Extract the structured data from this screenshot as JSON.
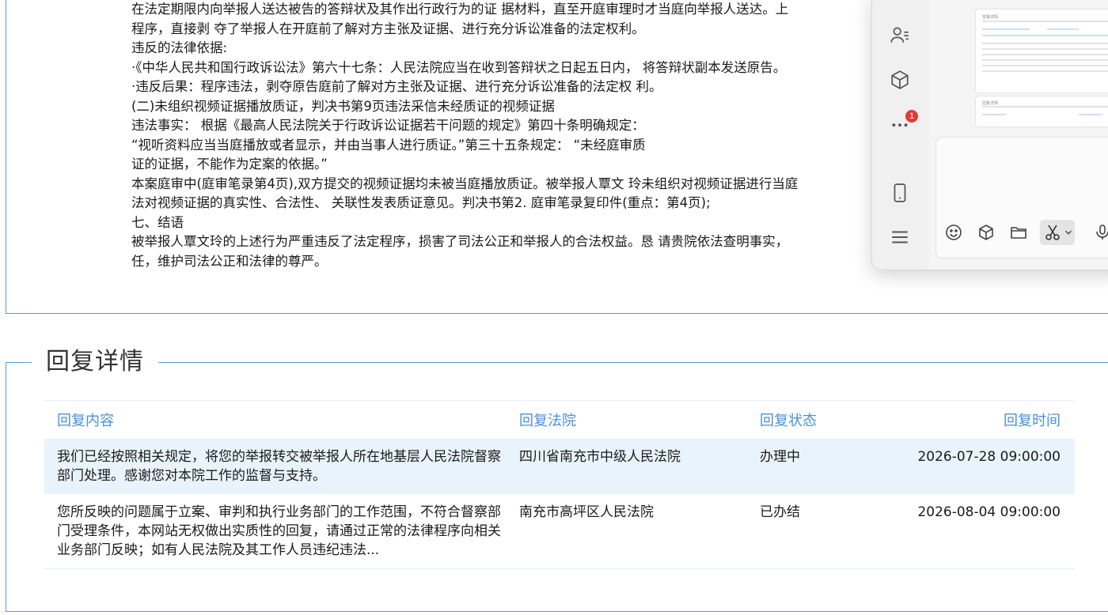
{
  "report": {
    "lines": [
      "在法定期限内向举报人送达被告的答辩状及其作出行政行为的证 据材料，直至开庭审理时才当庭向举报人送达。上",
      "程序，直接剥 夺了举报人在开庭前了解对方主张及证据、进行充分诉讼准备的法定权利。",
      "违反的法律依据:",
      "·《中华人民共和国行政诉讼法》第六十七条：人民法院应当在收到答辩状之日起五日内， 将答辩状副本发送原告。",
      "·违反后果：程序违法，剥夺原告庭前了解对方主张及证据、进行充分诉讼准备的法定权 利。",
      "(二)未组织视频证据播放质证，判决书第9页违法采信未经质证的视频证据",
      "违法事实： 根据《最高人民法院关于行政诉讼证据若干问题的规定》第四十条明确规定：",
      "“视听资料应当当庭播放或者显示，并由当事人进行质证。”第三十五条规定： “未经庭审质",
      "证的证据，不能作为定案的依据。”",
      "本案庭审中(庭审笔录第4页),双方提交的视频证据均未被当庭播放质证。被举报人覃文 玲未组织对视频证据进行当庭",
      "法对视频证据的真实性、合法性、 关联性发表质证意见。判决书第2. 庭审笔录复印件(重点：第4页);",
      "七、结语",
      "被举报人覃文玲的上述行为严重违反了法定程序，损害了司法公正和举报人的合法权益。恳 请贵院依法查明事实，",
      "任，维护司法公正和法律的尊严。"
    ]
  },
  "reply": {
    "legend": "回复详情",
    "headers": {
      "content": "回复内容",
      "court": "回复法院",
      "status": "回复状态",
      "time": "回复时间"
    },
    "rows": [
      {
        "content": "我们已经按照相关规定，将您的举报转交被举报人所在地基层人民法院督察部门处理。感谢您对本院工作的监督与支持。",
        "court": "四川省南充市中级人民法院",
        "status": "办理中",
        "time": "2026-07-28 09:00:00"
      },
      {
        "content": "您所反映的问题属于立案、审判和执行业务部门的工作范围，不符合督察部门受理条件，本网站无权做出实质性的回复，请通过正常的法律程序向相关业务部门反映；如有人民法院及其工作人员违纪违法...",
        "court": "南充市高坪区人民法院",
        "status": "已办结",
        "time": "2026-08-04 09:00:00"
      }
    ]
  },
  "chat": {
    "badge_count": "1",
    "thumb_title": "举报详情",
    "thumb_title2": "回复详情",
    "icons": [
      "contacts-icon",
      "cube-icon",
      "more-icon",
      "phone-icon",
      "menu-icon",
      "emoji-icon",
      "box-icon",
      "folder-icon",
      "scissors-icon",
      "chevron-down-icon",
      "mic-icon"
    ]
  },
  "colors": {
    "border": "#5b9bd5",
    "header_text": "#4a90d9",
    "highlight_row": "#e9f3fb",
    "badge": "#e53935"
  }
}
